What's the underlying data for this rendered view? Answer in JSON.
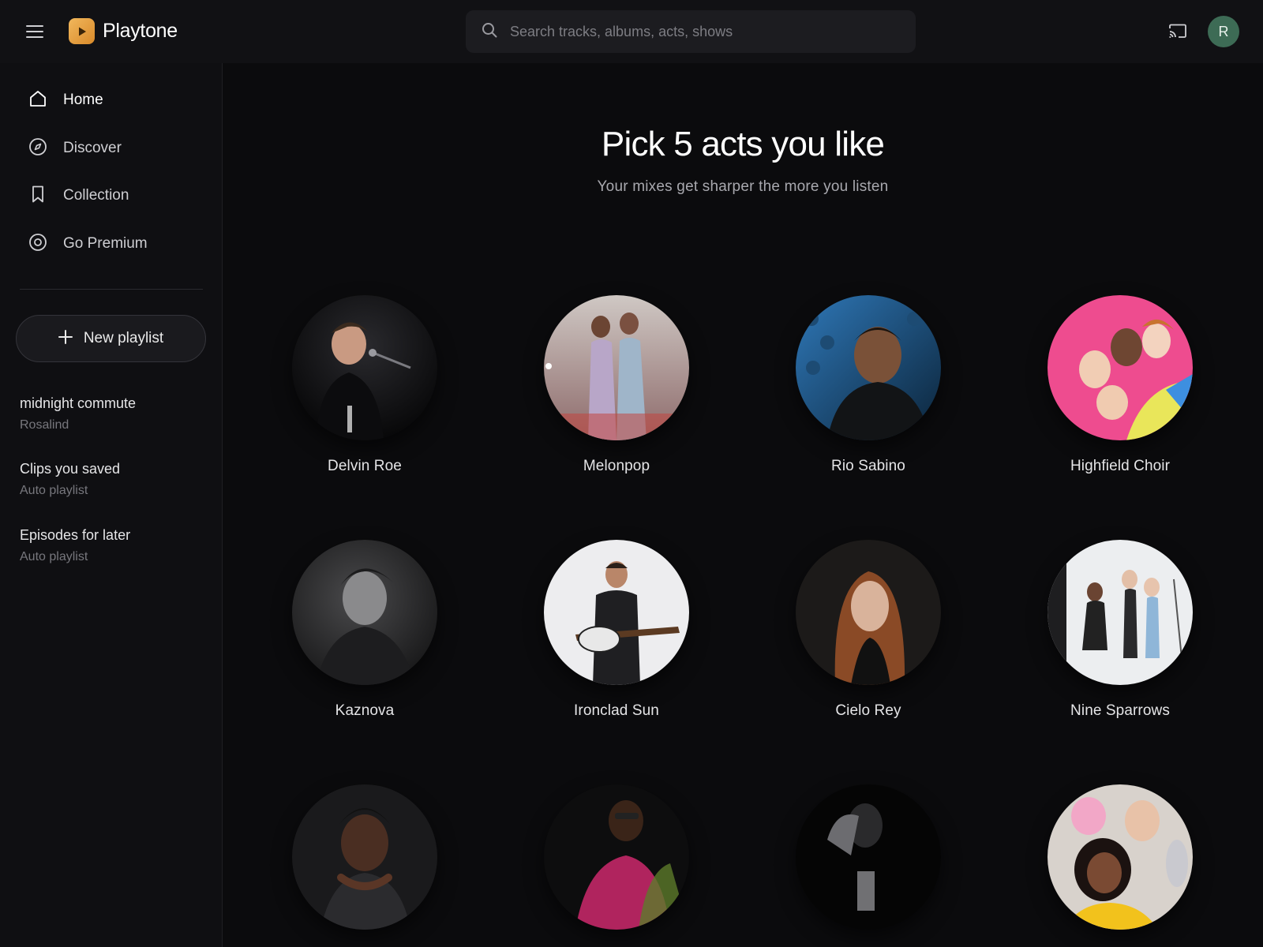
{
  "app": {
    "name": "Playtone",
    "brand_color": "#e5a043",
    "background": "#0b0b0d"
  },
  "topbar": {
    "menu_icon": "hamburger-menu-icon",
    "search": {
      "placeholder": "Search tracks, albums, acts, shows",
      "value": ""
    },
    "cast_icon": "cast-icon",
    "avatar_initial": "R",
    "avatar_color": "#3d6b55"
  },
  "sidebar": {
    "nav": [
      {
        "label": "Home",
        "icon": "home-icon",
        "active": true
      },
      {
        "label": "Discover",
        "icon": "compass-icon",
        "active": false
      },
      {
        "label": "Collection",
        "icon": "bookmark-icon",
        "active": false
      },
      {
        "label": "Go Premium",
        "icon": "premium-icon",
        "active": false
      }
    ],
    "new_playlist_label": "New playlist",
    "playlists": [
      {
        "title": "midnight commute",
        "subtitle": "Rosalind"
      },
      {
        "title": "Clips you saved",
        "subtitle": "Auto playlist"
      },
      {
        "title": "Episodes for later",
        "subtitle": "Auto playlist"
      }
    ]
  },
  "main": {
    "title": "Pick 5 acts you like",
    "subtitle": "Your mixes get sharper the more you listen",
    "acts": [
      {
        "name": "Delvin Roe"
      },
      {
        "name": "Melonpop"
      },
      {
        "name": "Rio Sabino"
      },
      {
        "name": "Highfield Choir"
      },
      {
        "name": "Kaznova"
      },
      {
        "name": "Ironclad Sun"
      },
      {
        "name": "Cielo Rey"
      },
      {
        "name": "Nine Sparrows"
      },
      {
        "name": ""
      },
      {
        "name": ""
      },
      {
        "name": ""
      },
      {
        "name": ""
      }
    ]
  }
}
